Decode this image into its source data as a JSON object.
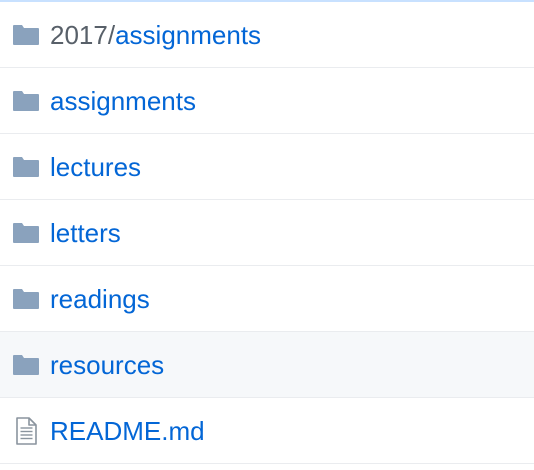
{
  "colors": {
    "link": "#0366d6",
    "muted": "#586069",
    "folder_icon": "#79b8ff",
    "row_border": "#eaecef",
    "hover_bg": "#f6f8fa",
    "top_border": "#c8e1ff"
  },
  "files": [
    {
      "type": "folder",
      "icon": "folder-icon",
      "prefix": "2017/",
      "name": "assignments"
    },
    {
      "type": "folder",
      "icon": "folder-icon",
      "prefix": "",
      "name": "assignments"
    },
    {
      "type": "folder",
      "icon": "folder-icon",
      "prefix": "",
      "name": "lectures"
    },
    {
      "type": "folder",
      "icon": "folder-icon",
      "prefix": "",
      "name": "letters"
    },
    {
      "type": "folder",
      "icon": "folder-icon",
      "prefix": "",
      "name": "readings"
    },
    {
      "type": "folder",
      "icon": "folder-icon",
      "prefix": "",
      "name": "resources",
      "hovered": true
    },
    {
      "type": "file",
      "icon": "file-text-icon",
      "prefix": "",
      "name": "README.md"
    }
  ]
}
